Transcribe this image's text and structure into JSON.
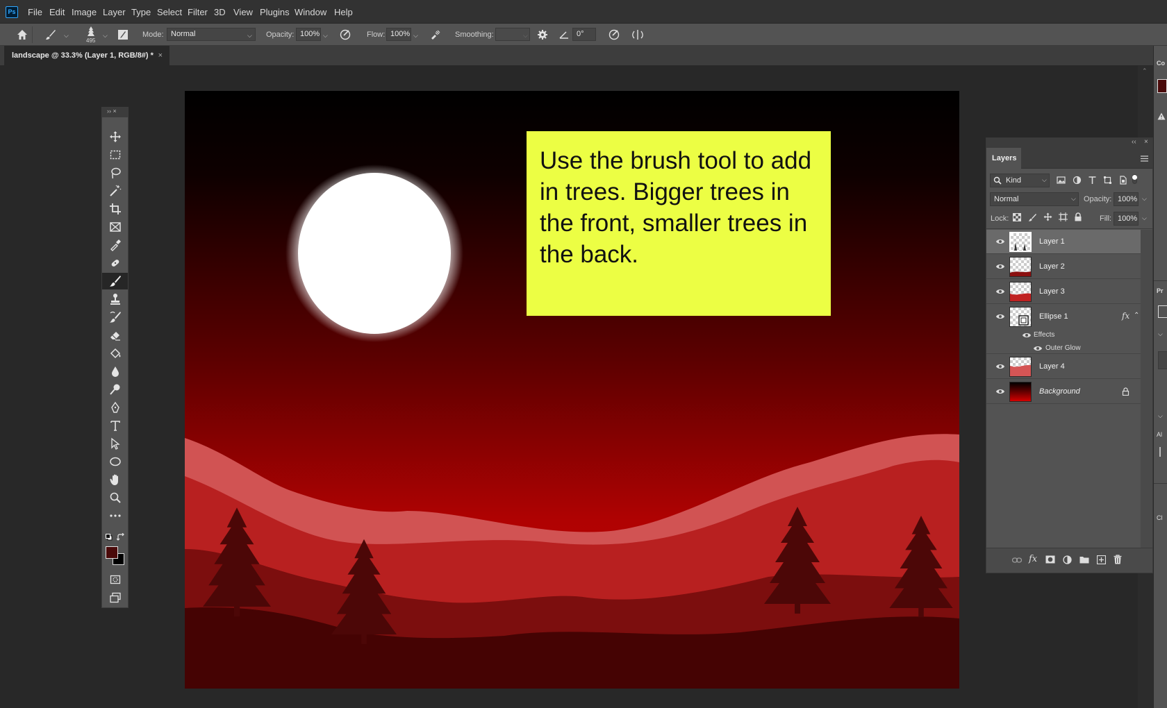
{
  "app": {
    "logo": "Ps"
  },
  "menu": [
    "File",
    "Edit",
    "Image",
    "Layer",
    "Type",
    "Select",
    "Filter",
    "3D",
    "View",
    "Plugins",
    "Window",
    "Help"
  ],
  "options": {
    "brush_size": "495",
    "mode_label": "Mode:",
    "mode_value": "Normal",
    "opacity_label": "Opacity:",
    "opacity_value": "100%",
    "flow_label": "Flow:",
    "flow_value": "100%",
    "smoothing_label": "Smoothing:",
    "angle_value": "0°"
  },
  "document": {
    "tab_title": "landscape @ 33.3% (Layer 1, RGB/8#) *",
    "close_glyph": "×"
  },
  "toolbar": {
    "header": "›› ×",
    "tools": [
      "move-tool",
      "marquee-tool",
      "lasso-tool",
      "magic-wand-tool",
      "crop-tool",
      "frame-tool",
      "eyedropper-tool",
      "healing-tool",
      "brush-tool",
      "clone-stamp-tool",
      "history-brush-tool",
      "eraser-tool",
      "paint-bucket-tool",
      "blur-tool",
      "dodge-tool",
      "pen-tool",
      "type-tool",
      "path-select-tool",
      "ellipse-tool",
      "hand-tool",
      "zoom-tool",
      "more-tools"
    ],
    "foreground_color": "#4a0a0a",
    "background_color": "#000000"
  },
  "note": {
    "text": "Use the brush tool to add in trees. Bigger trees in the front, smaller trees in the back."
  },
  "layers_panel": {
    "title": "Layers",
    "filter_kind": "Kind",
    "blend_mode": "Normal",
    "opacity_label": "Opacity:",
    "opacity_value": "100%",
    "lock_label": "Lock:",
    "fill_label": "Fill:",
    "fill_value": "100%",
    "layers": [
      {
        "name": "Layer 1",
        "selected": true
      },
      {
        "name": "Layer 2",
        "selected": false
      },
      {
        "name": "Layer 3",
        "selected": false
      },
      {
        "name": "Ellipse 1",
        "selected": false,
        "fx": "fx",
        "effects_label": "Effects",
        "effect": "Outer Glow"
      },
      {
        "name": "Layer 4",
        "selected": false
      },
      {
        "name": "Background",
        "selected": false,
        "locked": true
      }
    ]
  },
  "right_dock": {
    "labels": [
      "Co",
      "Pr",
      "Al",
      "Cl"
    ]
  }
}
